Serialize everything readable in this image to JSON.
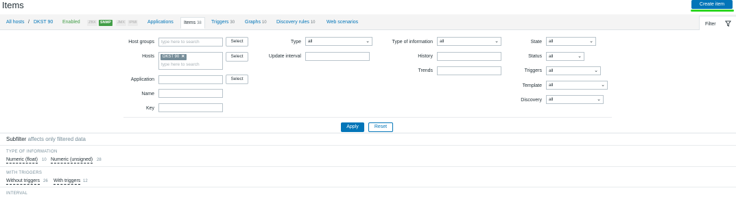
{
  "page": {
    "title": "Items",
    "create_button": "Create item"
  },
  "nav": {
    "all_hosts": "All hosts",
    "separator": "/",
    "host": "DKST 90",
    "status": "Enabled",
    "tags": [
      "ZBX",
      "SNMP",
      "JMX",
      "IPMI"
    ],
    "tabs": [
      {
        "label": "Applications",
        "count": ""
      },
      {
        "label": "Items",
        "count": "38"
      },
      {
        "label": "Triggers",
        "count": "30"
      },
      {
        "label": "Graphs",
        "count": "10"
      },
      {
        "label": "Discovery rules",
        "count": "10"
      },
      {
        "label": "Web scenarios",
        "count": ""
      }
    ],
    "filter_label": "Filter"
  },
  "filter": {
    "host_groups_label": "Host groups",
    "host_groups_placeholder": "type here to search",
    "hosts_label": "Hosts",
    "hosts_chip": "DKST 90",
    "hosts_placeholder": "type here to search",
    "application_label": "Application",
    "name_label": "Name",
    "key_label": "Key",
    "select_label": "Select",
    "type_label": "Type",
    "type_value": "all",
    "update_interval_label": "Update interval",
    "type_of_information_label": "Type of information",
    "type_of_information_value": "all",
    "history_label": "History",
    "trends_label": "Trends",
    "state_label": "State",
    "state_value": "all",
    "status_label": "Status",
    "status_value": "all",
    "triggers_label": "Triggers",
    "triggers_value": "all",
    "template_label": "Template",
    "template_value": "all",
    "discovery_label": "Discovery",
    "discovery_value": "all",
    "apply_label": "Apply",
    "reset_label": "Reset"
  },
  "subfilter": {
    "title": "Subfilter",
    "note": "affects only filtered data",
    "sections": [
      {
        "title": "TYPE OF INFORMATION",
        "items": [
          {
            "label": "Numeric (float)",
            "count": "10"
          },
          {
            "label": "Numeric (unsigned)",
            "count": "28"
          }
        ]
      },
      {
        "title": "WITH TRIGGERS",
        "items": [
          {
            "label": "Without triggers",
            "count": "26"
          },
          {
            "label": "With triggers",
            "count": "12"
          }
        ]
      },
      {
        "title": "INTERVAL",
        "items": []
      }
    ]
  },
  "colors": {
    "accent": "#0275b8",
    "green": "#429e47",
    "highlight": "#2bd61f"
  }
}
